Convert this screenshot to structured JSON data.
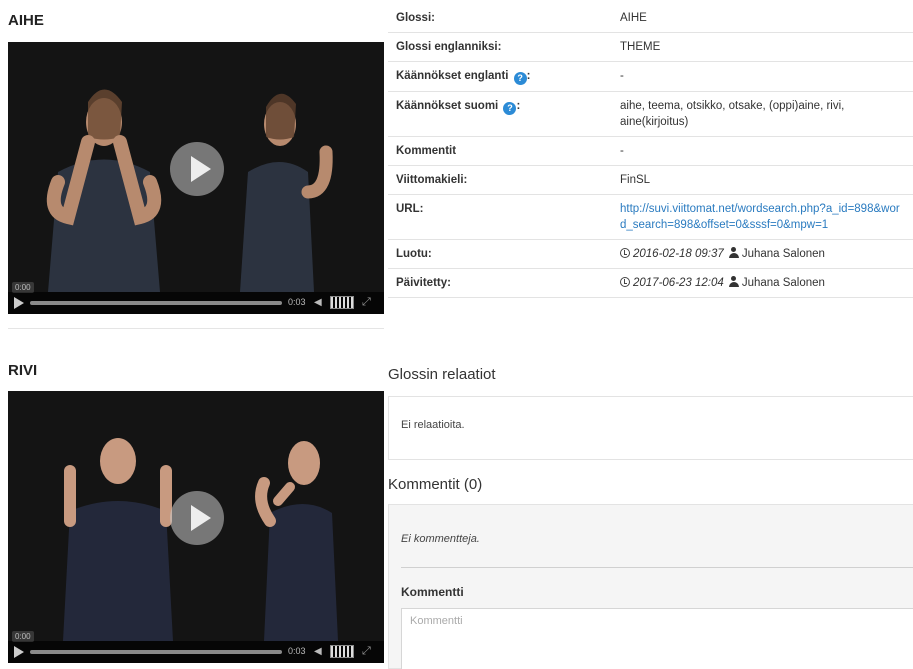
{
  "videos": [
    {
      "title": "AIHE",
      "start_time": "0:00",
      "duration": "0:03"
    },
    {
      "title": "RIVI",
      "start_time": "0:00",
      "duration": "0:03"
    }
  ],
  "meta": {
    "rows": [
      {
        "key": "Glossi:",
        "value": "AIHE"
      },
      {
        "key": "Glossi englanniksi:",
        "value": "THEME"
      },
      {
        "key": "Käännökset englanti",
        "value": "-"
      },
      {
        "key": "Käännökset suomi",
        "value": "aihe, teema, otsikko, otsake, (oppi)aine, rivi, aine(kirjoitus)"
      },
      {
        "key": "Kommentit",
        "value": "-"
      },
      {
        "key": "Viittomakieli:",
        "value": "FinSL"
      },
      {
        "key": "URL:",
        "value": "http://suvi.viittomat.net/wordsearch.php?a_id=898&word_search=898&offset=0&sssf=0&mpw=1"
      }
    ],
    "colon": ":",
    "help_glyph": "?",
    "created": {
      "key": "Luotu:",
      "date": "2016-02-18 09:37",
      "user": "Juhana Salonen"
    },
    "updated": {
      "key": "Päivitetty:",
      "date": "2017-06-23 12:04",
      "user": "Juhana Salonen"
    }
  },
  "relations": {
    "title": "Glossin relaatiot",
    "empty_text": "Ei relaatioita."
  },
  "comments": {
    "title": "Kommentit (0)",
    "empty_text": "Ei kommentteja.",
    "field_label": "Kommentti",
    "placeholder": "Kommentti"
  },
  "colors": {
    "link": "#2a7bc0",
    "help_icon": "#2c8bd6",
    "comments_bg": "#f5f5f5"
  }
}
